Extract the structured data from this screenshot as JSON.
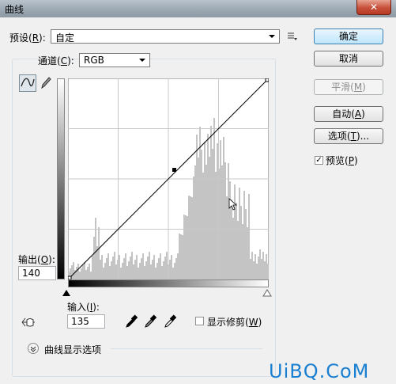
{
  "window": {
    "title": "曲线",
    "close_label": "✕"
  },
  "preset": {
    "label": "预设(",
    "key": "R",
    "label_end": "):",
    "value": "自定"
  },
  "channel": {
    "label": "通道(",
    "key": "C",
    "label_end": "):",
    "value": "RGB"
  },
  "buttons": {
    "ok": "确定",
    "cancel": "取消",
    "smooth": "平滑(",
    "smooth_key": "M",
    "smooth_end": ")",
    "auto": "自动(",
    "auto_key": "A",
    "auto_end": ")",
    "options": "选项(",
    "options_key": "T",
    "options_end": ")..."
  },
  "preview": {
    "label": "预览(",
    "key": "P",
    "label_end": ")",
    "checked": true
  },
  "output": {
    "label": "输出(",
    "key": "O",
    "label_end": "):",
    "value": "140"
  },
  "input": {
    "label": "输入(",
    "key": "I",
    "label_end": "):",
    "value": "135"
  },
  "clipping": {
    "label": "显示修剪(",
    "key": "W",
    "label_end": ")",
    "checked": false
  },
  "display_options": {
    "label": "曲线显示选项"
  },
  "watermark": "UiBQ.CoM",
  "icons": {
    "preset_menu": "preset-options-icon",
    "curve_tool": "curve-point-tool-icon",
    "pencil_tool": "pencil-tool-icon",
    "hand_tool": "on-image-adjust-icon",
    "black_dropper": "black-point-eyedropper-icon",
    "gray_dropper": "gray-point-eyedropper-icon",
    "white_dropper": "white-point-eyedropper-icon",
    "expand": "expand-chevron-icon"
  },
  "colors": {
    "ok_button": "#bee6fd",
    "watermark": "#1a7fd0"
  }
}
